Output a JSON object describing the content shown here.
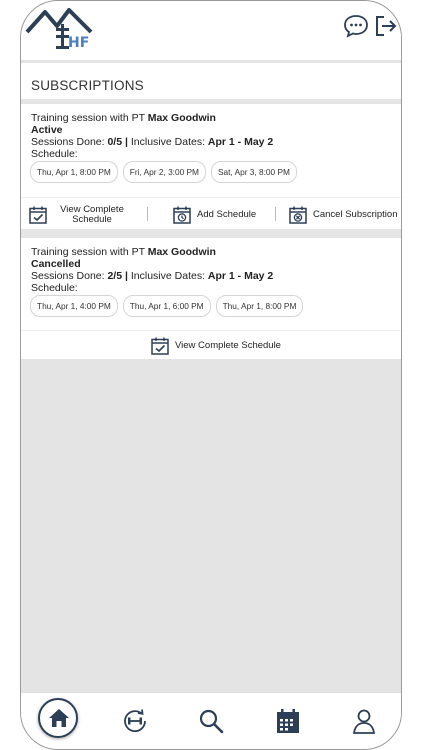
{
  "header": {
    "logo_text": "HF",
    "icons": {
      "chat": "chat-bubble-icon",
      "logout": "logout-icon"
    }
  },
  "page": {
    "title": "SUBSCRIPTIONS"
  },
  "subscriptions": [
    {
      "title_prefix": "Training session with PT ",
      "trainer": "Max Goodwin",
      "status": "Active",
      "sessions_label": "Sessions Done: ",
      "sessions_value": "0/5",
      "separator": "|",
      "dates_label": "Inclusive Dates: ",
      "dates_value": "Apr 1 - May 2",
      "schedule_label": "Schedule:",
      "slots": [
        "Thu, Apr 1, 8:00 PM",
        "Fri, Apr 2, 3:00 PM",
        "Sat, Apr 3, 8:00 PM"
      ],
      "actions": {
        "view_line1": "View Complete",
        "view_line2": "Schedule",
        "add": "Add Schedule",
        "cancel": "Cancel Subscription"
      }
    },
    {
      "title_prefix": "Training session with PT ",
      "trainer": "Max Goodwin",
      "status": "Cancelled",
      "sessions_label": "Sessions Done: ",
      "sessions_value": "2/5",
      "separator": "|",
      "dates_label": "Inclusive Dates: ",
      "dates_value": "Apr 1 - May 2",
      "schedule_label": "Schedule:",
      "slots": [
        "Thu, Apr 1, 4:00 PM",
        "Thu, Apr 1, 6:00 PM",
        "Thu, Apr 1, 8:00 PM"
      ],
      "actions": {
        "view": "View Complete Schedule"
      }
    }
  ],
  "nav": {
    "items": [
      "home-icon",
      "workout-icon",
      "search-icon",
      "calendar-icon",
      "profile-icon"
    ],
    "active": "home"
  },
  "colors": {
    "brand": "#2d3e57",
    "active": "#7cc77d",
    "cancelled": "#2f7fd0",
    "logo_accent": "#4a7fc0"
  }
}
